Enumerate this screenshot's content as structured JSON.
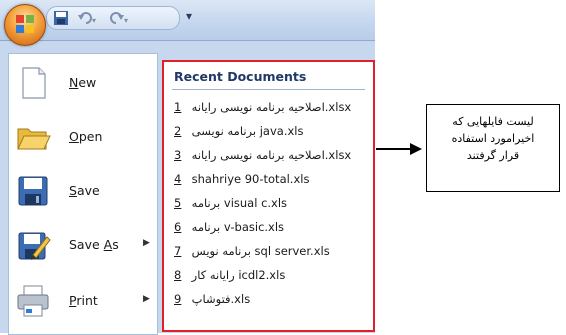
{
  "titlebar": {
    "qat_items": [
      {
        "icon": "save-icon"
      },
      {
        "icon": "undo-icon"
      },
      {
        "icon": "redo-icon"
      }
    ],
    "customize_glyph": "▾"
  },
  "menu": {
    "commands": [
      {
        "id": "new",
        "accel": "N",
        "rest": "ew",
        "icon": "new-document-icon",
        "submenu": false
      },
      {
        "id": "open",
        "accel": "O",
        "rest": "pen",
        "icon": "open-folder-icon",
        "submenu": false
      },
      {
        "id": "save",
        "accel": "S",
        "rest": "ave",
        "icon": "floppy-disk-icon",
        "submenu": false
      },
      {
        "id": "save-as",
        "before": "Save ",
        "accel": "A",
        "rest": "s",
        "icon": "save-as-icon",
        "submenu": true
      },
      {
        "id": "print",
        "accel": "P",
        "rest": "rint",
        "icon": "printer-icon",
        "submenu": true
      }
    ],
    "recent": {
      "heading": "Recent Documents",
      "items": [
        {
          "num": "1",
          "name": "اصلاحیه برنامه نویسی رایانه.xlsx"
        },
        {
          "num": "2",
          "name": "برنامه نویسی java.xls"
        },
        {
          "num": "3",
          "name": "اصلاحیه برنامه نویسی رایانه.xlsx"
        },
        {
          "num": "4",
          "name": "shahriye 90-total.xls"
        },
        {
          "num": "5",
          "name": "برنامه visual c.xls"
        },
        {
          "num": "6",
          "name": "برنامه v-basic.xls"
        },
        {
          "num": "7",
          "name": "برنامه نویس sql server.xls"
        },
        {
          "num": "8",
          "name": "رایانه کار icdl2.xls"
        },
        {
          "num": "9",
          "name": "فتوشاپ.xls"
        }
      ]
    }
  },
  "annotation": {
    "text_line1": "لیست فایلهایی که",
    "text_line2": "اخیرامورد استفاده",
    "text_line3": "قرار گرفتند"
  },
  "colors": {
    "highlight_border": "#e0202a",
    "menu_background": "#c7d8ee"
  }
}
